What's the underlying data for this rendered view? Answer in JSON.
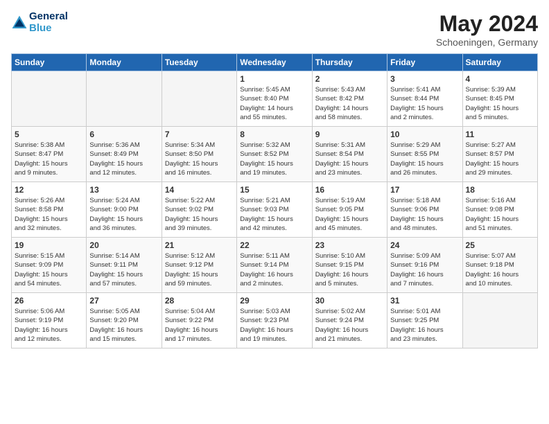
{
  "header": {
    "logo_general": "General",
    "logo_blue": "Blue",
    "month_year": "May 2024",
    "location": "Schoeningen, Germany"
  },
  "weekdays": [
    "Sunday",
    "Monday",
    "Tuesday",
    "Wednesday",
    "Thursday",
    "Friday",
    "Saturday"
  ],
  "weeks": [
    [
      {
        "day": "",
        "info": ""
      },
      {
        "day": "",
        "info": ""
      },
      {
        "day": "",
        "info": ""
      },
      {
        "day": "1",
        "info": "Sunrise: 5:45 AM\nSunset: 8:40 PM\nDaylight: 14 hours\nand 55 minutes."
      },
      {
        "day": "2",
        "info": "Sunrise: 5:43 AM\nSunset: 8:42 PM\nDaylight: 14 hours\nand 58 minutes."
      },
      {
        "day": "3",
        "info": "Sunrise: 5:41 AM\nSunset: 8:44 PM\nDaylight: 15 hours\nand 2 minutes."
      },
      {
        "day": "4",
        "info": "Sunrise: 5:39 AM\nSunset: 8:45 PM\nDaylight: 15 hours\nand 5 minutes."
      }
    ],
    [
      {
        "day": "5",
        "info": "Sunrise: 5:38 AM\nSunset: 8:47 PM\nDaylight: 15 hours\nand 9 minutes."
      },
      {
        "day": "6",
        "info": "Sunrise: 5:36 AM\nSunset: 8:49 PM\nDaylight: 15 hours\nand 12 minutes."
      },
      {
        "day": "7",
        "info": "Sunrise: 5:34 AM\nSunset: 8:50 PM\nDaylight: 15 hours\nand 16 minutes."
      },
      {
        "day": "8",
        "info": "Sunrise: 5:32 AM\nSunset: 8:52 PM\nDaylight: 15 hours\nand 19 minutes."
      },
      {
        "day": "9",
        "info": "Sunrise: 5:31 AM\nSunset: 8:54 PM\nDaylight: 15 hours\nand 23 minutes."
      },
      {
        "day": "10",
        "info": "Sunrise: 5:29 AM\nSunset: 8:55 PM\nDaylight: 15 hours\nand 26 minutes."
      },
      {
        "day": "11",
        "info": "Sunrise: 5:27 AM\nSunset: 8:57 PM\nDaylight: 15 hours\nand 29 minutes."
      }
    ],
    [
      {
        "day": "12",
        "info": "Sunrise: 5:26 AM\nSunset: 8:58 PM\nDaylight: 15 hours\nand 32 minutes."
      },
      {
        "day": "13",
        "info": "Sunrise: 5:24 AM\nSunset: 9:00 PM\nDaylight: 15 hours\nand 36 minutes."
      },
      {
        "day": "14",
        "info": "Sunrise: 5:22 AM\nSunset: 9:02 PM\nDaylight: 15 hours\nand 39 minutes."
      },
      {
        "day": "15",
        "info": "Sunrise: 5:21 AM\nSunset: 9:03 PM\nDaylight: 15 hours\nand 42 minutes."
      },
      {
        "day": "16",
        "info": "Sunrise: 5:19 AM\nSunset: 9:05 PM\nDaylight: 15 hours\nand 45 minutes."
      },
      {
        "day": "17",
        "info": "Sunrise: 5:18 AM\nSunset: 9:06 PM\nDaylight: 15 hours\nand 48 minutes."
      },
      {
        "day": "18",
        "info": "Sunrise: 5:16 AM\nSunset: 9:08 PM\nDaylight: 15 hours\nand 51 minutes."
      }
    ],
    [
      {
        "day": "19",
        "info": "Sunrise: 5:15 AM\nSunset: 9:09 PM\nDaylight: 15 hours\nand 54 minutes."
      },
      {
        "day": "20",
        "info": "Sunrise: 5:14 AM\nSunset: 9:11 PM\nDaylight: 15 hours\nand 57 minutes."
      },
      {
        "day": "21",
        "info": "Sunrise: 5:12 AM\nSunset: 9:12 PM\nDaylight: 15 hours\nand 59 minutes."
      },
      {
        "day": "22",
        "info": "Sunrise: 5:11 AM\nSunset: 9:14 PM\nDaylight: 16 hours\nand 2 minutes."
      },
      {
        "day": "23",
        "info": "Sunrise: 5:10 AM\nSunset: 9:15 PM\nDaylight: 16 hours\nand 5 minutes."
      },
      {
        "day": "24",
        "info": "Sunrise: 5:09 AM\nSunset: 9:16 PM\nDaylight: 16 hours\nand 7 minutes."
      },
      {
        "day": "25",
        "info": "Sunrise: 5:07 AM\nSunset: 9:18 PM\nDaylight: 16 hours\nand 10 minutes."
      }
    ],
    [
      {
        "day": "26",
        "info": "Sunrise: 5:06 AM\nSunset: 9:19 PM\nDaylight: 16 hours\nand 12 minutes."
      },
      {
        "day": "27",
        "info": "Sunrise: 5:05 AM\nSunset: 9:20 PM\nDaylight: 16 hours\nand 15 minutes."
      },
      {
        "day": "28",
        "info": "Sunrise: 5:04 AM\nSunset: 9:22 PM\nDaylight: 16 hours\nand 17 minutes."
      },
      {
        "day": "29",
        "info": "Sunrise: 5:03 AM\nSunset: 9:23 PM\nDaylight: 16 hours\nand 19 minutes."
      },
      {
        "day": "30",
        "info": "Sunrise: 5:02 AM\nSunset: 9:24 PM\nDaylight: 16 hours\nand 21 minutes."
      },
      {
        "day": "31",
        "info": "Sunrise: 5:01 AM\nSunset: 9:25 PM\nDaylight: 16 hours\nand 23 minutes."
      },
      {
        "day": "",
        "info": ""
      }
    ]
  ]
}
